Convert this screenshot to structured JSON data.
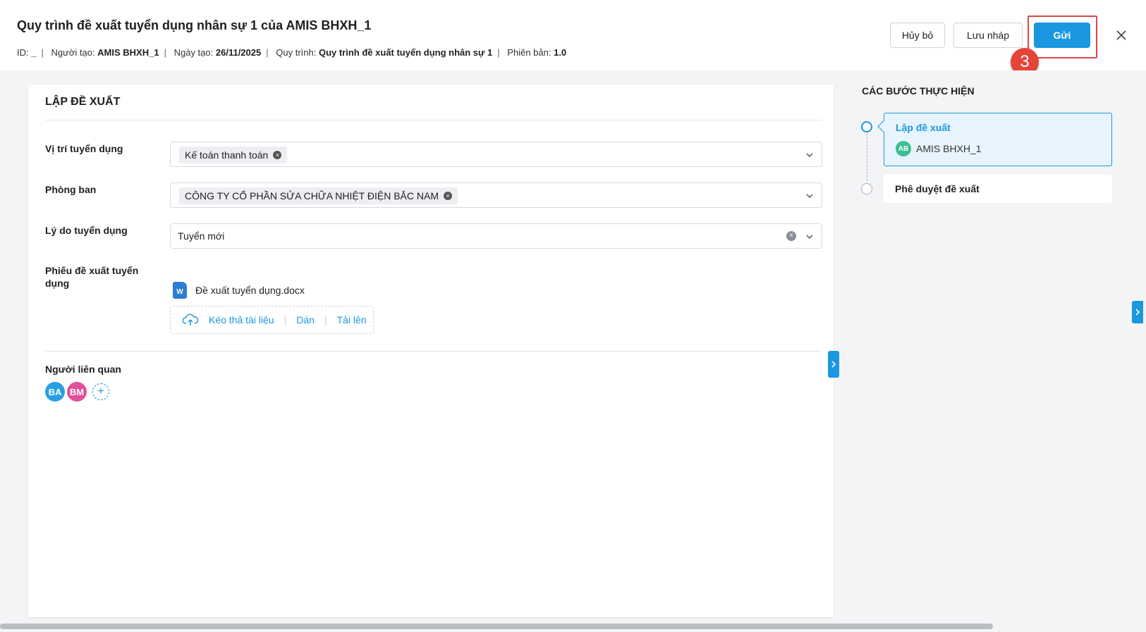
{
  "header": {
    "title": "Quy trình đề xuất tuyển dụng nhân sự 1 của AMIS BHXH_1",
    "meta": {
      "id_label": "ID:",
      "id_value": "_",
      "creator_label": "Người tạo:",
      "creator_value": "AMIS BHXH_1",
      "date_label": "Ngày tạo:",
      "date_value": "26/11/2025",
      "process_label": "Quy trình:",
      "process_value": "Quy trình đề xuất tuyển dụng nhân sự 1",
      "version_label": "Phiên bản:",
      "version_value": "1.0"
    },
    "cancel_label": "Hủy bỏ",
    "draft_label": "Lưu nháp",
    "send_label": "Gửi",
    "step_badge": "3"
  },
  "form": {
    "section_title": "LẬP ĐỀ XUẤT",
    "position": {
      "label": "Vị trí tuyển dụng",
      "chip": "Kế toán thanh toán"
    },
    "department": {
      "label": "Phòng ban",
      "chip": "CÔNG TY CỔ PHẦN SỬA CHỮA NHIỆT ĐIỆN BẮC NAM"
    },
    "reason": {
      "label": "Lý do tuyển dụng",
      "value": "Tuyển mới"
    },
    "attachment": {
      "label": "Phiếu đề xuất tuyển dụng",
      "file_icon_letter": "W",
      "file_name": "Đề xuất tuyển dụng.docx",
      "drag_label": "Kéo thả tài liệu",
      "paste_label": "Dán",
      "upload_label": "Tải lên"
    },
    "related": {
      "label": "Người liên quan",
      "avatars": [
        "BA",
        "BM"
      ],
      "add_symbol": "+"
    }
  },
  "steps": {
    "title": "CÁC BƯỚC THỰC HIỆN",
    "items": [
      {
        "name": "Lập đề xuất",
        "user_initials": "AB",
        "user_name": "AMIS BHXH_1"
      },
      {
        "name": "Phê duyệt đề xuất"
      }
    ]
  },
  "colors": {
    "accent": "#1a97e0",
    "highlight": "#e04545",
    "badge": "#e5443a"
  }
}
